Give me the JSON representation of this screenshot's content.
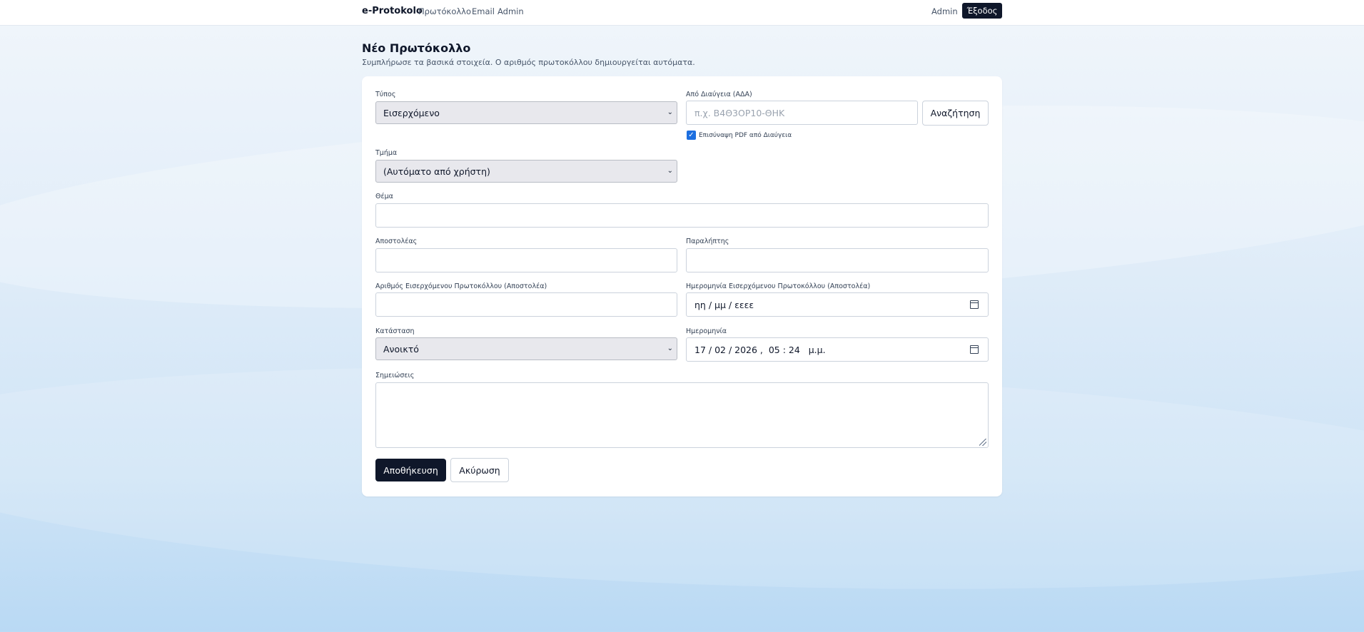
{
  "nav": {
    "brand": "e-Protokolo",
    "links": [
      "Πρωτόκολλο",
      "Email",
      "Admin"
    ],
    "user": "Admin",
    "logout": "Έξοδος"
  },
  "page": {
    "title": "Νέο Πρωτόκολλο",
    "subtitle": "Συμπλήρωσε τα βασικά στοιχεία. Ο αριθμός πρωτοκόλλου δημιουργείται αυτόματα."
  },
  "form": {
    "type_label": "Τύπος",
    "type_value": "Εισερχόμενο",
    "ada_label": "Από Διαύγεια (ΑΔΑ)",
    "ada_placeholder": "π.χ. Β4Θ3ΟΡ10-ΘΗΚ",
    "search_button": "Αναζήτηση",
    "attach_pdf_label": "Επισύναψη PDF από Διαύγεια",
    "attach_pdf_checked": true,
    "department_label": "Τμήμα",
    "department_value": "(Αυτόματο από χρήστη)",
    "subject_label": "Θέμα",
    "subject_value": "",
    "sender_label": "Αποστολέας",
    "sender_value": "",
    "recipient_label": "Παραλήπτης",
    "recipient_value": "",
    "incoming_number_label": "Αριθμός Εισερχόμενου Πρωτοκόλλου (Αποστολέα)",
    "incoming_number_value": "",
    "incoming_date_label": "Ημερομηνία Εισερχόμενου Πρωτοκόλλου (Αποστολέα)",
    "incoming_date_placeholder": "ηη / μμ / εεεε",
    "status_label": "Κατάσταση",
    "status_value": "Ανοικτό",
    "date_label": "Ημερομηνία",
    "date_value": "17 / 02 / 2026 ,  05 : 24   μ.μ.",
    "notes_label": "Σημειώσεις",
    "notes_value": "",
    "save_button": "Αποθήκευση",
    "cancel_button": "Ακύρωση"
  },
  "icons": [
    "chevron-down-icon",
    "calendar-icon",
    "checkbox-check-icon",
    "resize-handle-icon"
  ],
  "colors": {
    "primary": "#0f172a",
    "checkbox": "#1d6fe0",
    "background": "#dceaf7"
  }
}
